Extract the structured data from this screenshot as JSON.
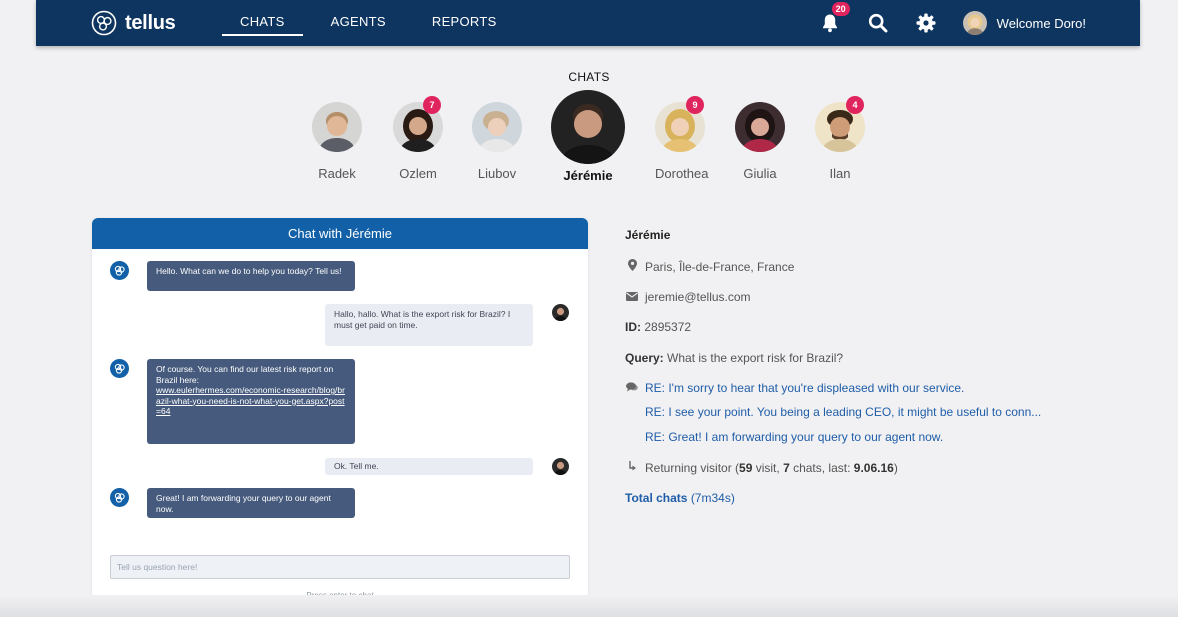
{
  "app": {
    "brand": "tellus",
    "nav": [
      {
        "label": "CHATS",
        "active": true
      },
      {
        "label": "AGENTS",
        "active": false
      },
      {
        "label": "REPORTS",
        "active": false
      }
    ],
    "notifications_count": "20",
    "welcome": "Welcome Doro!",
    "icons": [
      "bell-icon",
      "search-icon",
      "gear-icon"
    ]
  },
  "chats": {
    "title": "CHATS",
    "contacts": [
      {
        "name": "Radek",
        "badge": null
      },
      {
        "name": "Ozlem",
        "badge": "7"
      },
      {
        "name": "Liubov",
        "badge": null
      },
      {
        "name": "Jérémie",
        "badge": null,
        "active": true
      },
      {
        "name": "Dorothea",
        "badge": "9"
      },
      {
        "name": "Giulia",
        "badge": null
      },
      {
        "name": "Ilan",
        "badge": "4"
      }
    ]
  },
  "chat": {
    "header": "Chat with Jérémie",
    "messages": [
      {
        "from": "bot",
        "text": "Hello. What can we do to help you today? Tell us!"
      },
      {
        "from": "user",
        "text": "Hallo, hallo. What is the export risk for Brazil? I must get paid on time."
      },
      {
        "from": "bot",
        "text": "Of course. You can find our latest risk report on Brazil here:",
        "link": "www.eulerhermes.com/economic-research/blog/brazil-what-you-need-is-not-what-you-get.aspx?post=64"
      },
      {
        "from": "user",
        "text": "Ok. Tell me."
      },
      {
        "from": "bot",
        "text": "Great!  I am forwarding your query to our agent now."
      }
    ],
    "input_placeholder": "Tell us question here!",
    "hint": "Press enter to chat"
  },
  "visitor": {
    "name": "Jérémie",
    "location": "Paris, Île-de-France, France",
    "email": "jeremie@tellus.com",
    "id_label": "ID:",
    "id_value": "2895372",
    "query_label": "Query:",
    "query_value": "What is the export risk for Brazil?",
    "threads": [
      "RE: I'm sorry to hear that you're displeased with our service.",
      "RE: I see your point. You being a leading CEO, it might be useful to conn...",
      "RE: Great!  I am forwarding your query to our agent now."
    ],
    "returning_prefix": "Returning visitor (",
    "visits": "59",
    "visits_suffix": " visit, ",
    "chats": "7",
    "chats_suffix": " chats, last: ",
    "last": "9.06.16",
    "returning_close": ")",
    "total_label": "Total chats",
    "total_value": "(7m34s)"
  },
  "colors": {
    "topbar": "#0e3560",
    "accent": "#1160a8",
    "badge": "#e0245e",
    "bot_bubble": "#455a7c"
  }
}
